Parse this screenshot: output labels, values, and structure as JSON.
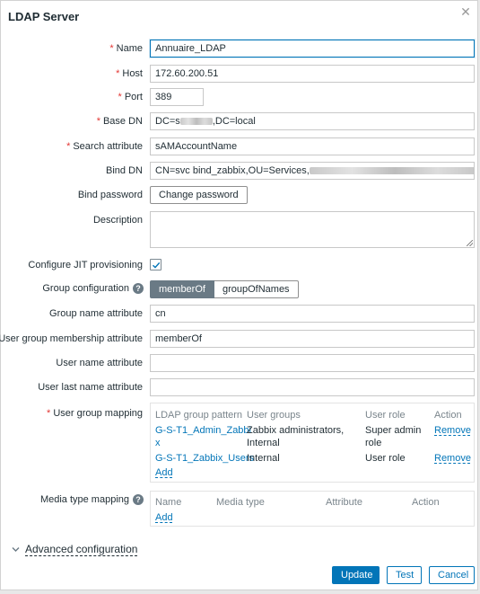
{
  "dialog": {
    "title": "LDAP Server",
    "close_icon": "close-icon"
  },
  "form": {
    "name": {
      "label": "Name",
      "required": true,
      "value": "Annuaire_LDAP"
    },
    "host": {
      "label": "Host",
      "required": true,
      "value": "172.60.200.51"
    },
    "port": {
      "label": "Port",
      "required": true,
      "value": "389"
    },
    "base_dn": {
      "label": "Base DN",
      "required": true,
      "value_prefix": "DC=s",
      "value_suffix": ",DC=local"
    },
    "search_attribute": {
      "label": "Search attribute",
      "required": true,
      "value": "sAMAccountName"
    },
    "bind_dn": {
      "label": "Bind DN",
      "value_prefix": "CN=svc bind_zabbix,OU=Services,"
    },
    "bind_password": {
      "label": "Bind password",
      "button": "Change password"
    },
    "description": {
      "label": "Description",
      "value": ""
    },
    "jit": {
      "label": "Configure JIT provisioning",
      "checked": true
    },
    "group_configuration": {
      "label": "Group configuration",
      "options": [
        "memberOf",
        "groupOfNames"
      ],
      "selected": "memberOf"
    },
    "group_name_attribute": {
      "label": "Group name attribute",
      "value": "cn"
    },
    "user_group_membership_attribute": {
      "label": "User group membership attribute",
      "value": "memberOf"
    },
    "user_name_attribute": {
      "label": "User name attribute",
      "value": ""
    },
    "user_last_name_attribute": {
      "label": "User last name attribute",
      "value": ""
    }
  },
  "user_group_mapping": {
    "label": "User group mapping",
    "required": true,
    "headers": [
      "LDAP group pattern",
      "User groups",
      "User role",
      "Action"
    ],
    "rows": [
      {
        "pattern_line1": "G-S-T1_Admin_Zabbi",
        "pattern_line2": "x",
        "groups_line1": "Zabbix administrators,",
        "groups_line2": "Internal",
        "role_line1": "Super admin",
        "role_line2": "role",
        "action": "Remove"
      },
      {
        "pattern_line1": "G-S-T1_Zabbix_Users",
        "pattern_line2": "",
        "groups_line1": "Internal",
        "groups_line2": "",
        "role_line1": "User role",
        "role_line2": "",
        "action": "Remove"
      }
    ],
    "add": "Add"
  },
  "media_type_mapping": {
    "label": "Media type mapping",
    "headers": [
      "Name",
      "Media type",
      "Attribute",
      "Action"
    ],
    "add": "Add"
  },
  "advanced": {
    "label": "Advanced configuration"
  },
  "footer": {
    "update": "Update",
    "test": "Test",
    "cancel": "Cancel"
  },
  "colors": {
    "accent": "#0275b8",
    "required": "#e33734",
    "toggle_on": "#6a7a85"
  }
}
